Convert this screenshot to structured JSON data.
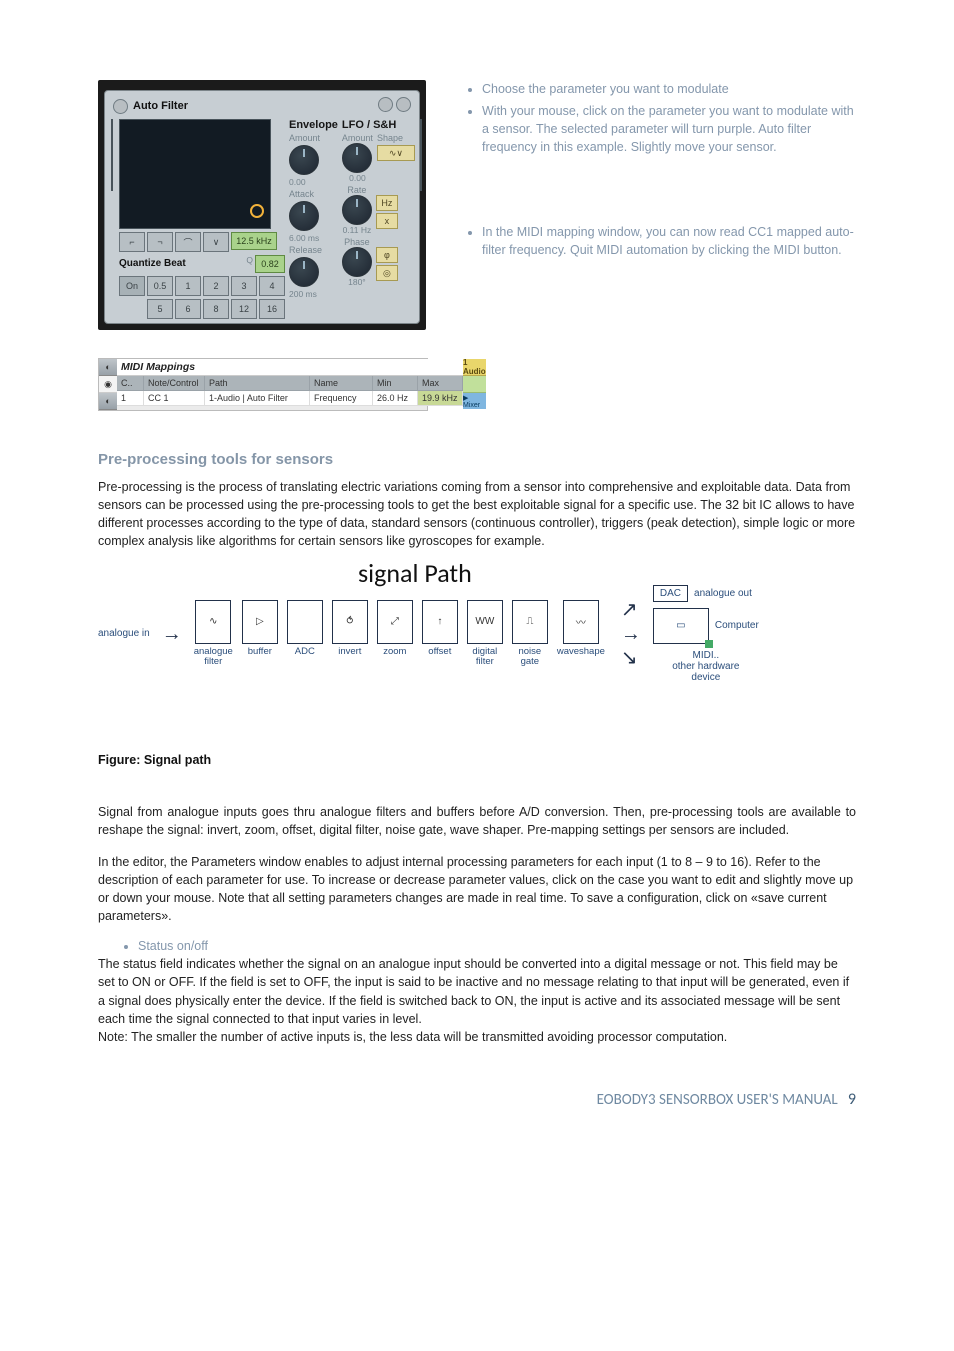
{
  "top_notes": {
    "bullet1": "Choose the parameter you want to modulate",
    "bullet2": "With your mouse, click on the parameter you want to modulate with a sensor. The selected parameter will turn purple. Auto filter frequency in this example. Slightly move your sensor.",
    "bullet3": "In the MIDI mapping window, you can now read CC1 mapped auto-filter frequency. Quit MIDI automation by clicking the MIDI button."
  },
  "plugin": {
    "title": "Auto Filter",
    "freq_val": "12.5 kHz",
    "q_label": "Q",
    "q_val": "0.82",
    "quantize_label": "Quantize Beat",
    "qb_row1": [
      "On",
      "0.5",
      "1",
      "2",
      "3",
      "4"
    ],
    "qb_row2": [
      "5",
      "6",
      "8",
      "12",
      "16"
    ],
    "env_head": "Envelope",
    "env_amount_label": "Amount",
    "env_amount_val": "0.00",
    "env_attack_label": "Attack",
    "env_attack_val": "6.00 ms",
    "env_release_label": "Release",
    "env_release_val": "200 ms",
    "lfo_head": "LFO / S&H",
    "lfo_amount_label": "Amount",
    "lfo_amount_val": "0.00",
    "lfo_shape_label": "Shape",
    "lfo_rate_label": "Rate",
    "lfo_rate_val": "0.11 Hz",
    "lfo_hz": "Hz",
    "lfo_x": "x",
    "lfo_phase_label": "Phase",
    "lfo_phase_val": "180°",
    "lfo_phi": "φ",
    "lfo_spin": "◎"
  },
  "mappings": {
    "title": "MIDI Mappings",
    "head": {
      "c1": "C..",
      "c2": "Note/Control",
      "c3": "Path",
      "c4": "Name",
      "c5": "Min",
      "c6": "Max"
    },
    "row": {
      "c1": "1",
      "c2": "CC 1",
      "c3": "1-Audio | Auto Filter",
      "c4": "Frequency",
      "c5": "26.0 Hz",
      "c6": "19.9 kHz"
    },
    "right_label": "1 Audio",
    "right_b": "▶ Mixer"
  },
  "section_heading": "Pre-processing tools for sensors",
  "para1": "Pre-processing is the process of translating electric variations coming from a sensor into comprehensive and exploitable data. Data from sensors can be processed using the pre-processing tools to get the best exploitable signal for a specific use. The 32 bit IC allows to have different processes according to the type of data, standard sensors (continuous controller), triggers (peak detection), simple logic or more complex analysis like algorithms for certain sensors like gyroscopes for example.",
  "signal": {
    "title": "signal Path",
    "in_label": "analogue in",
    "nodes": [
      "analogue\nfilter",
      "buffer",
      "ADC",
      "invert",
      "zoom",
      "offset",
      "digital\nfilter",
      "noise\ngate",
      "waveshape"
    ],
    "dac": "DAC",
    "analogue_out": "analogue out",
    "computer": "Computer",
    "midi_out": "MIDI..\nother hardware\ndevice"
  },
  "fig_caption": "Figure: Signal path",
  "para2": "Signal from analogue inputs goes thru analogue filters and buffers before A/D conversion. Then, pre-processing tools are available to reshape the signal: invert, zoom, offset, digital filter, noise gate, wave shaper. Pre-mapping settings per sensors are included.",
  "para3": "In the editor, the Parameters window enables to adjust internal processing parameters for each input (1 to 8 – 9 to 16). Refer to the description of each parameter for use. To increase or decrease parameter values, click on the case you want to edit and slightly move up or down your mouse. Note that all setting parameters changes are made in real time. To save a configuration, click on «save current parameters».",
  "status_bullet": "Status on/off",
  "para4": "The status field indicates whether the signal on an analogue input should be converted into a digital message or not. This field may be set to ON or OFF. If the field is set to OFF, the input is said to be inactive and no message relating to that input will be generated, even if a signal does physically enter the device. If the field is switched back to ON, the input is active and its associated message will be sent each time the signal connected to that input varies in level.",
  "para4b": "Note: The smaller the number of active inputs is, the less data will be transmitted avoiding processor computation.",
  "footer": {
    "title": "EOBODY3 SENSORBOX USER'S MANUAL",
    "page": "9"
  }
}
